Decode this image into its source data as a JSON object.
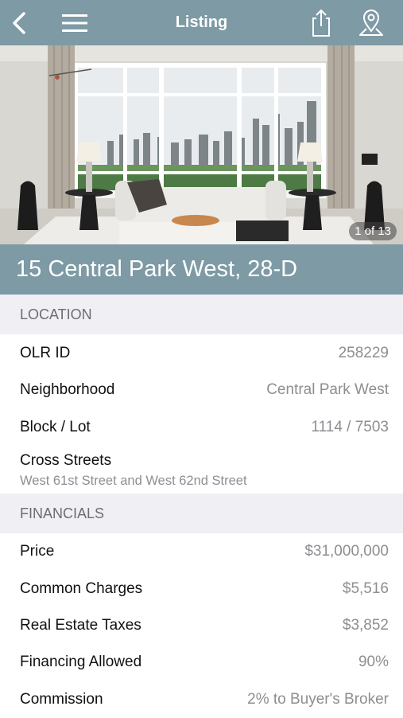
{
  "navbar": {
    "title": "Listing",
    "icons": [
      "back-chevron-icon",
      "hamburger-menu-icon",
      "share-icon",
      "map-pin-icon"
    ]
  },
  "hero": {
    "photo_counter": "1 of 13"
  },
  "listing": {
    "title": "15 Central Park West, 28-D"
  },
  "location": {
    "header": "LOCATION",
    "rows": [
      {
        "label": "OLR ID",
        "value": "258229"
      },
      {
        "label": "Neighborhood",
        "value": "Central Park West"
      },
      {
        "label": "Block / Lot",
        "value": "1114 / 7503"
      }
    ],
    "cross_streets": {
      "label": "Cross Streets",
      "value": "West 61st Street and West 62nd Street"
    }
  },
  "financials": {
    "header": "FINANCIALS",
    "rows": [
      {
        "label": "Price",
        "value": "$31,000,000"
      },
      {
        "label": "Common Charges",
        "value": "$5,516"
      },
      {
        "label": "Real Estate Taxes",
        "value": "$3,852"
      },
      {
        "label": "Financing Allowed",
        "value": "90%"
      },
      {
        "label": "Commission",
        "value": "2% to Buyer's Broker"
      }
    ]
  },
  "colors": {
    "accent": "#7d9aa5",
    "section_bg": "#efeff4",
    "secondary_text": "#8e8e93"
  }
}
